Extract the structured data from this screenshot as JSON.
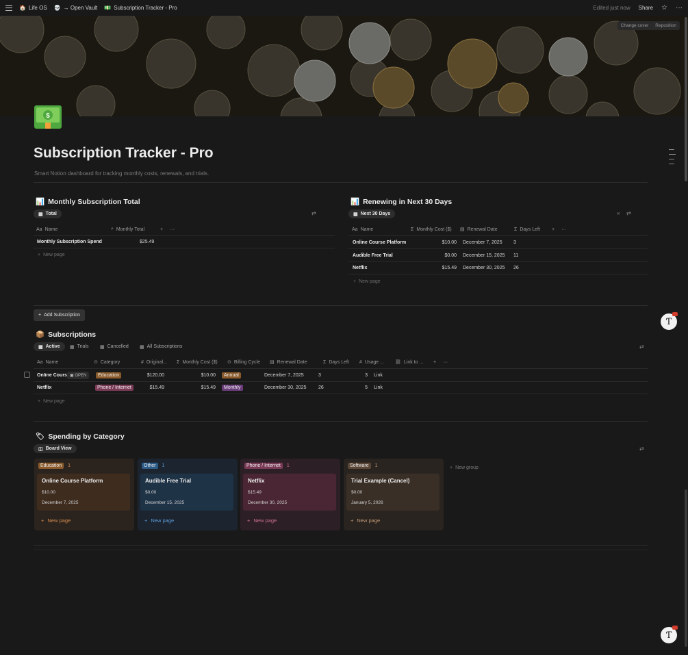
{
  "breadcrumb": {
    "workspace": "Life OS",
    "vault": "→ Open Vault",
    "page": "Subscription Tracker - Pro"
  },
  "topbar": {
    "edited": "Edited just now",
    "share": "Share"
  },
  "cover": {
    "change": "Change cover",
    "reposition": "Reposition"
  },
  "page": {
    "title": "Subscription Tracker - Pro",
    "subtitle": "Smart Notion dashboard for tracking monthly costs, renewals, and trials."
  },
  "monthly": {
    "title": "Monthly Subscription Total",
    "view": "Total",
    "columns": [
      "Name",
      "Monthly Total"
    ],
    "rows": [
      {
        "name": "Monthly Subscription Spend",
        "total": "$25.49"
      }
    ],
    "new_page": "New page"
  },
  "renewing": {
    "title": "Renewing in Next 30 Days",
    "view": "Next 30 Days",
    "columns": [
      "Name",
      "Monthly Cost ($)",
      "Renewal Date",
      "Days Left"
    ],
    "rows": [
      {
        "name": "Online Course Platform",
        "cost": "$10.00",
        "date": "December 7, 2025",
        "days": "3"
      },
      {
        "name": "Audible Free Trial",
        "cost": "$0.00",
        "date": "December 15, 2025",
        "days": "11"
      },
      {
        "name": "Netflix",
        "cost": "$15.49",
        "date": "December 30, 2025",
        "days": "26"
      }
    ],
    "new_page": "New page"
  },
  "add_button": "Add Subscription",
  "subs": {
    "title": "Subscriptions",
    "tabs": [
      "Active",
      "Trials",
      "Cancelled",
      "All Subscriptions"
    ],
    "columns": [
      "Name",
      "Category",
      "Original...",
      "Monthly Cost ($)",
      "Billing Cycle",
      "Renewal Date",
      "Days Left",
      "Usage ...",
      "Link to ..."
    ],
    "open_label": "OPEN",
    "rows": [
      {
        "name": "Online Cours",
        "category": "Education",
        "original": "$120.00",
        "cost": "$10.00",
        "cycle": "Annual",
        "date": "December 7, 2025",
        "days": "3",
        "usage": "3",
        "link": "Link"
      },
      {
        "name": "Netflix",
        "category": "Phone / Internet",
        "original": "$15.49",
        "cost": "$15.49",
        "cycle": "Monthly",
        "date": "December 30, 2025",
        "days": "26",
        "usage": "5",
        "link": "Link"
      }
    ],
    "new_page": "New page"
  },
  "spending": {
    "title": "Spending by Category",
    "view": "Board View",
    "groups": [
      {
        "name": "Education",
        "count": "1",
        "card": {
          "title": "Online Course Platform",
          "cost": "$10.00",
          "date": "December 7, 2025"
        },
        "new_page": "New page",
        "colors": {
          "bg": "#2b241e",
          "card": "#3e2c1f",
          "tag": "#8a5a2b",
          "accent": "#d48a4e"
        }
      },
      {
        "name": "Other",
        "count": "1",
        "card": {
          "title": "Audible Free Trial",
          "cost": "$0.00",
          "date": "December 15, 2025"
        },
        "new_page": "New page",
        "colors": {
          "bg": "#1c2430",
          "card": "#1f3347",
          "tag": "#2d5b88",
          "accent": "#5c9bd8"
        }
      },
      {
        "name": "Phone / Internet",
        "count": "1",
        "card": {
          "title": "Netflix",
          "cost": "$15.49",
          "date": "December 30, 2025"
        },
        "new_page": "New page",
        "colors": {
          "bg": "#2c1f26",
          "card": "#4a2533",
          "tag": "#7a3a56",
          "accent": "#d0708f"
        }
      },
      {
        "name": "Software",
        "count": "1",
        "card": {
          "title": "Trial Example (Cancel)",
          "cost": "$0.00",
          "date": "January 5, 2026"
        },
        "new_page": "New page",
        "colors": {
          "bg": "#29241f",
          "card": "#3a2f27",
          "tag": "#5a4636",
          "accent": "#c49a78"
        }
      }
    ],
    "new_group": "New group"
  }
}
